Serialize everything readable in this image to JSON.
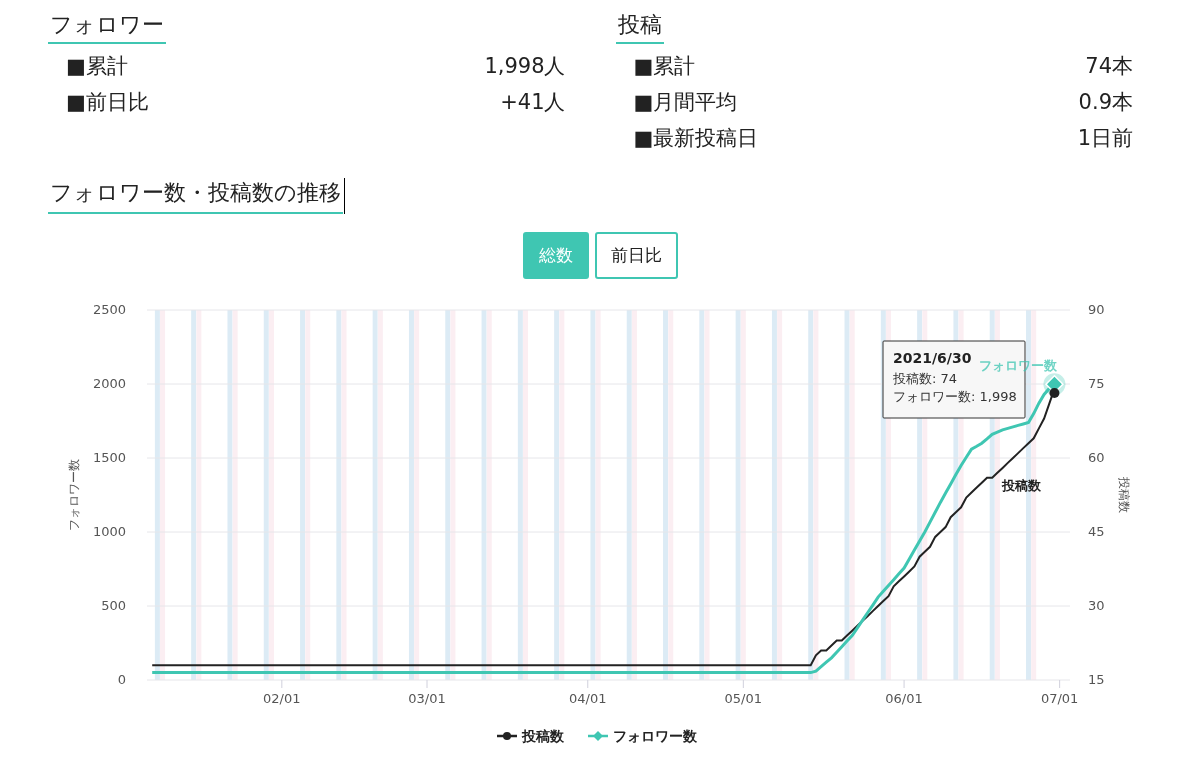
{
  "follower_stats": {
    "heading": "フォロワー",
    "rows": [
      {
        "label": "■累計",
        "value": "1,998人"
      },
      {
        "label": "■前日比",
        "value": "+41人"
      }
    ]
  },
  "post_stats": {
    "heading": "投稿",
    "rows": [
      {
        "label": "■累計",
        "value": "74本"
      },
      {
        "label": "■月間平均",
        "value": "0.9本"
      },
      {
        "label": "■最新投稿日",
        "value": "1日前"
      }
    ]
  },
  "trend": {
    "title": "フォロワー数・投稿数の推移",
    "toggle": [
      {
        "label": "総数",
        "selected": true
      },
      {
        "label": "前日比",
        "selected": false
      }
    ],
    "chart_data": {
      "type": "line",
      "grid": true,
      "legend": "bottom",
      "ylabel": "フォロワー数",
      "y2label": "投稿数",
      "ylim": [
        0,
        2500
      ],
      "y2lim": [
        15,
        90
      ],
      "yticks": [
        0,
        500,
        1000,
        1500,
        2000,
        2500
      ],
      "y2ticks": [
        15,
        30,
        45,
        60,
        75,
        90
      ],
      "categories": [
        null,
        null,
        null,
        null,
        null,
        null,
        null,
        null,
        null,
        null,
        null,
        null,
        null,
        null,
        null,
        null,
        null,
        null,
        null,
        null,
        null,
        null,
        null,
        null,
        null,
        "02/01",
        null,
        null,
        null,
        null,
        null,
        null,
        null,
        null,
        null,
        null,
        null,
        null,
        null,
        null,
        null,
        null,
        null,
        null,
        null,
        null,
        null,
        null,
        null,
        null,
        null,
        null,
        null,
        "03/01",
        null,
        null,
        null,
        null,
        null,
        null,
        null,
        null,
        null,
        null,
        null,
        null,
        null,
        null,
        null,
        null,
        null,
        null,
        null,
        null,
        null,
        null,
        null,
        null,
        null,
        null,
        null,
        null,
        null,
        null,
        "04/01",
        null,
        null,
        null,
        null,
        null,
        null,
        null,
        null,
        null,
        null,
        null,
        null,
        null,
        null,
        null,
        null,
        null,
        null,
        null,
        null,
        null,
        null,
        null,
        null,
        null,
        null,
        null,
        null,
        null,
        "05/01",
        null,
        null,
        null,
        null,
        null,
        null,
        null,
        null,
        null,
        null,
        null,
        null,
        null,
        null,
        null,
        null,
        null,
        null,
        null,
        null,
        null,
        null,
        null,
        null,
        null,
        null,
        null,
        null,
        null,
        null,
        "06/01",
        null,
        null,
        null,
        null,
        null,
        null,
        null,
        null,
        null,
        null,
        null,
        null,
        null,
        null,
        null,
        null,
        null,
        null,
        null,
        null,
        null,
        null,
        null,
        null,
        null,
        null,
        null,
        null,
        null,
        "07/01"
      ],
      "series": [
        {
          "name": "投稿数",
          "color": "#222222",
          "axis": "y2",
          "values": [
            18,
            18,
            18,
            18,
            18,
            18,
            18,
            18,
            18,
            18,
            18,
            18,
            18,
            18,
            18,
            18,
            18,
            18,
            18,
            18,
            18,
            18,
            18,
            18,
            18,
            18,
            18,
            18,
            18,
            18,
            18,
            18,
            18,
            18,
            18,
            18,
            18,
            18,
            18,
            18,
            18,
            18,
            18,
            18,
            18,
            18,
            18,
            18,
            18,
            18,
            18,
            18,
            18,
            18,
            18,
            18,
            18,
            18,
            18,
            18,
            18,
            18,
            18,
            18,
            18,
            18,
            18,
            18,
            18,
            18,
            18,
            18,
            18,
            18,
            18,
            18,
            18,
            18,
            18,
            18,
            18,
            18,
            18,
            18,
            18,
            18,
            18,
            18,
            18,
            18,
            18,
            18,
            18,
            18,
            18,
            18,
            18,
            18,
            18,
            18,
            18,
            18,
            18,
            18,
            18,
            18,
            18,
            18,
            18,
            18,
            18,
            18,
            18,
            18,
            18,
            18,
            18,
            18,
            18,
            18,
            18,
            18,
            18,
            18,
            18,
            18,
            18,
            18,
            20,
            21,
            21,
            22,
            23,
            23,
            24,
            25,
            26,
            27,
            28,
            29,
            30,
            31,
            32,
            34,
            35,
            36,
            37,
            38,
            40,
            41,
            42,
            44,
            45,
            46,
            48,
            49,
            50,
            52,
            53,
            54,
            55,
            56,
            56,
            57,
            58,
            59,
            60,
            61,
            62,
            63,
            64,
            66,
            68,
            71,
            74,
            null
          ]
        },
        {
          "name": "フォロワー数",
          "color": "#3fc6b2",
          "values": [
            50,
            50,
            50,
            50,
            50,
            50,
            50,
            50,
            50,
            50,
            50,
            50,
            50,
            50,
            50,
            50,
            50,
            50,
            50,
            50,
            50,
            50,
            50,
            50,
            50,
            50,
            50,
            50,
            50,
            50,
            50,
            50,
            50,
            50,
            50,
            50,
            50,
            50,
            50,
            50,
            50,
            50,
            50,
            50,
            50,
            50,
            50,
            50,
            50,
            50,
            50,
            50,
            50,
            50,
            50,
            50,
            50,
            50,
            50,
            50,
            50,
            50,
            50,
            50,
            50,
            50,
            50,
            50,
            50,
            50,
            50,
            50,
            50,
            50,
            50,
            50,
            50,
            50,
            50,
            50,
            50,
            50,
            50,
            50,
            50,
            50,
            50,
            50,
            50,
            50,
            50,
            50,
            50,
            50,
            50,
            50,
            50,
            50,
            50,
            50,
            50,
            50,
            50,
            50,
            50,
            50,
            50,
            50,
            50,
            50,
            50,
            50,
            50,
            50,
            50,
            50,
            50,
            50,
            50,
            50,
            50,
            50,
            50,
            50,
            50,
            50,
            50,
            50,
            60,
            90,
            120,
            150,
            188,
            225,
            263,
            300,
            352,
            404,
            456,
            508,
            560,
            599,
            639,
            678,
            718,
            757,
            818,
            878,
            939,
            1000,
            1067,
            1133,
            1200,
            1263,
            1325,
            1388,
            1450,
            1505,
            1560,
            1580,
            1600,
            1630,
            1660,
            1675,
            1690,
            1700,
            1710,
            1720,
            1730,
            1740,
            1800,
            1870,
            1930,
            1970,
            1998,
            null
          ]
        }
      ],
      "annotations": [
        "投稿数",
        "フォロワー数"
      ]
    },
    "tooltip": {
      "title": "2021/6/30",
      "lines": [
        "投稿数: 74",
        "フォロワー数: 1,998"
      ]
    }
  }
}
